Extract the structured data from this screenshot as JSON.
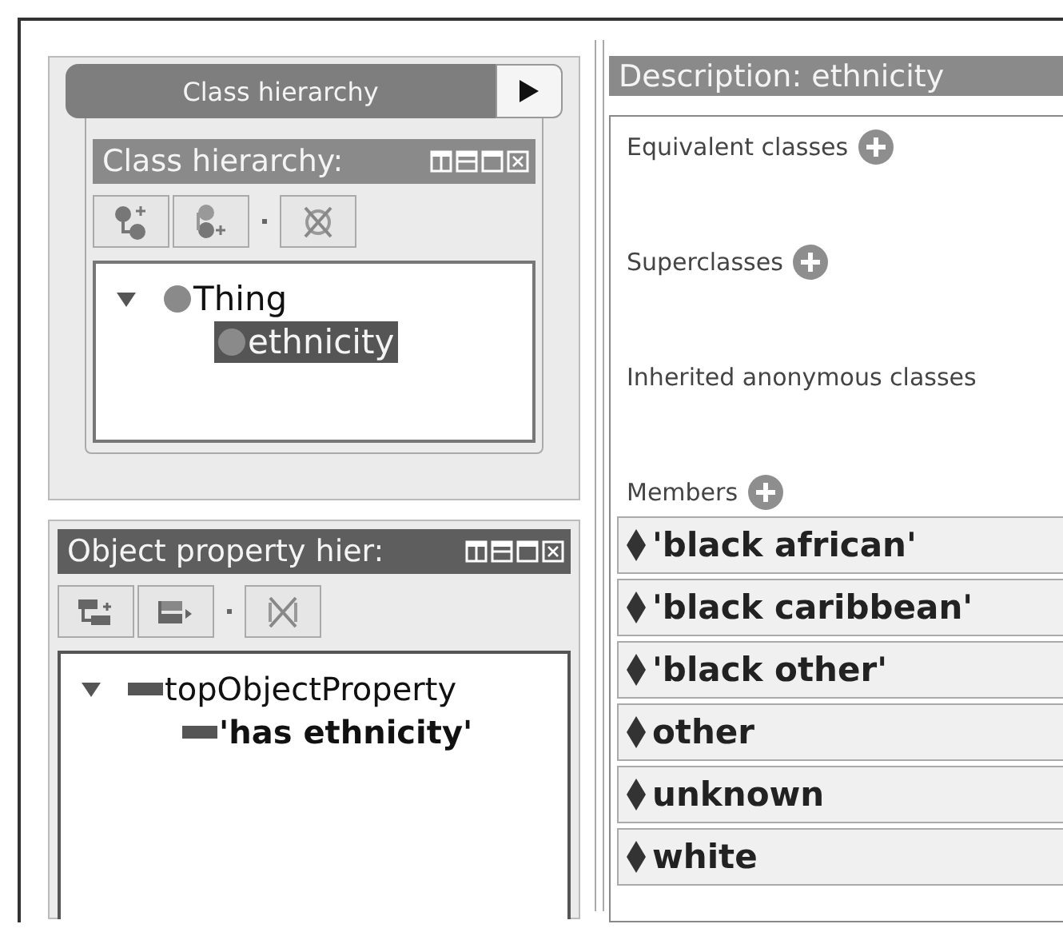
{
  "class_hierarchy_tab": {
    "label": "Class hierarchy",
    "selected": true
  },
  "class_hierarchy_panel": {
    "title": "Class hierarchy:",
    "tree": [
      {
        "label": "Thing",
        "expanded": true,
        "selected": false,
        "children": [
          {
            "label": "ethnicity",
            "selected": true
          }
        ]
      }
    ]
  },
  "object_property_panel": {
    "title": "Object property hier:",
    "tree": [
      {
        "label": "topObjectProperty",
        "expanded": true,
        "bold": false,
        "children": [
          {
            "label": "'has ethnicity'",
            "bold": true
          }
        ]
      }
    ]
  },
  "description": {
    "title": "Description: ethnicity",
    "sections": [
      {
        "label": "Equivalent classes",
        "addable": true
      },
      {
        "label": "Superclasses",
        "addable": true
      },
      {
        "label": "Inherited anonymous classes",
        "addable": false
      },
      {
        "label": "Members",
        "addable": true
      }
    ],
    "members": [
      "'black african'",
      "'black caribbean'",
      "'black other'",
      "other",
      "unknown",
      "white"
    ]
  }
}
